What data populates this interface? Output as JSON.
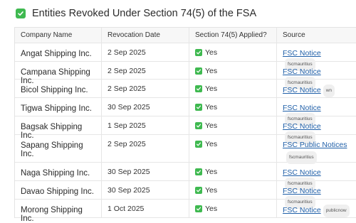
{
  "title": "Entities Revoked Under Section 74(5) of the FSA",
  "colors": {
    "check": "#3fb950",
    "link": "#1f5fa8",
    "tag_bg": "#efefef"
  },
  "columns": [
    "Company Name",
    "Revocation Date",
    "Section 74(5) Applied?",
    "Source"
  ],
  "rows": [
    {
      "company": "Angat Shipping Inc.",
      "date": "2 Sep 2025",
      "applied": "Yes",
      "source": "FSC Notice",
      "tag": "fscmauritius"
    },
    {
      "company": "Campana Shipping Inc.",
      "date": "2 Sep 2025",
      "applied": "Yes",
      "source": "FSC Notice",
      "tag": "fscmauritius"
    },
    {
      "company": "Bicol Shipping Inc.",
      "date": "2 Sep 2025",
      "applied": "Yes",
      "source": "FSC Notice",
      "tag": "wn"
    },
    {
      "company": "Tigwa Shipping Inc.",
      "date": "30 Sep 2025",
      "applied": "Yes",
      "source": "FSC Notice",
      "tag": "fscmauritius"
    },
    {
      "company": "Bagsak Shipping Inc.",
      "date": "1 Sep 2025",
      "applied": "Yes",
      "source": "FSC Notice",
      "tag": "fscmauritius"
    },
    {
      "company": "Sapang Shipping Inc.",
      "date": "2 Sep 2025",
      "applied": "Yes",
      "source": "FSC Public Notices",
      "tag": "fscmauritius"
    },
    {
      "company": "Naga Shipping Inc.",
      "date": "30 Sep 2025",
      "applied": "Yes",
      "source": "FSC Notice",
      "tag": "fscmauritius"
    },
    {
      "company": "Davao Shipping Inc.",
      "date": "30 Sep 2025",
      "applied": "Yes",
      "source": "FSC Notice",
      "tag": "fscmauritius"
    },
    {
      "company": "Morong Shipping Inc.",
      "date": "1 Oct 2025",
      "applied": "Yes",
      "source": "FSC Notice",
      "tag": "publicnow"
    }
  ]
}
